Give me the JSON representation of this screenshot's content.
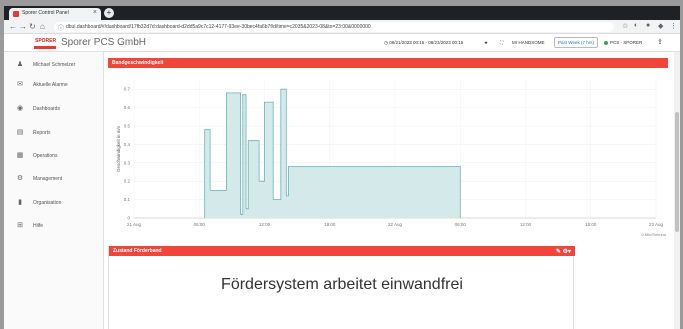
{
  "browser": {
    "tab_title": "Sporer Control Panel",
    "tab_close": "×",
    "new_tab": "+",
    "url": "dbui.dashboard/#/dashboard/17fb32d7d:dashboard-d2dd5a9c7c12-4177-93ee-30bec4fa6b7f/d/time=c2035&2023-08&to=23:00&0000000"
  },
  "header": {
    "logo_text": "SPORER",
    "company": "Sporer PCS GmbH",
    "date_range": "08/21/2023 00:15 - 08/23/2023 00:15",
    "user_menu": "Mr HANDSOME",
    "time_tab": "Past Week (7 hrs)",
    "status_label": "PCS · SPORER"
  },
  "sidebar": {
    "user": "Michael Schmelzer",
    "items": [
      {
        "label": "Aktuelle Alarme",
        "icon": "megaphone-icon"
      },
      {
        "label": "Dashboards",
        "icon": "palette-icon"
      },
      {
        "label": "Reports",
        "icon": "report-icon"
      },
      {
        "label": "Operations",
        "icon": "operations-icon"
      },
      {
        "label": "Management",
        "icon": "gears-icon"
      },
      {
        "label": "Organisation",
        "icon": "building-icon"
      },
      {
        "label": "Hilfe",
        "icon": "plus-box-icon"
      }
    ]
  },
  "panel1": {
    "title": "Bandgeschwindigkeit",
    "footer": "0 Min/Sekund"
  },
  "panel2": {
    "title": "Zustand Förderband",
    "message": "Fördersystem arbeitet einwandfrei"
  },
  "colors": {
    "accent": "#f0453a",
    "series_fill": "#d4eaea",
    "series_stroke": "#6bb3b3"
  },
  "chart_data": {
    "type": "area",
    "title": "Bandgeschwindigkeit",
    "ylabel": "Geschwindigkeit in m/s",
    "xlabel": "",
    "ylim": [
      0,
      0.75
    ],
    "yticks": [
      "0",
      "0.1",
      "0.2",
      "0.3",
      "0.4",
      "0.5",
      "0.6",
      "0.7"
    ],
    "xticks": [
      "21 Aug",
      "06:00",
      "12:00",
      "18:00",
      "22 Aug",
      "06:00",
      "12:00",
      "18:00",
      "23 Aug"
    ],
    "series": [
      {
        "x": [
          6.5,
          6.5,
          7.0,
          7.0,
          8.5,
          8.5,
          9.8,
          9.8,
          10.0,
          10.0,
          10.3,
          10.3,
          10.5,
          10.5,
          11.5,
          11.5,
          12.0,
          12.0,
          12.8,
          12.8,
          13.5,
          13.5,
          14.0,
          14.0,
          14.2,
          14.2,
          30.0,
          30.0
        ],
        "y": [
          0,
          0.48,
          0.48,
          0.15,
          0.15,
          0.68,
          0.68,
          0.02,
          0.02,
          0.67,
          0.67,
          0.05,
          0.05,
          0.42,
          0.42,
          0.2,
          0.2,
          0.63,
          0.63,
          0.1,
          0.1,
          0.7,
          0.7,
          0.12,
          0.12,
          0.28,
          0.28,
          0
        ]
      }
    ]
  }
}
